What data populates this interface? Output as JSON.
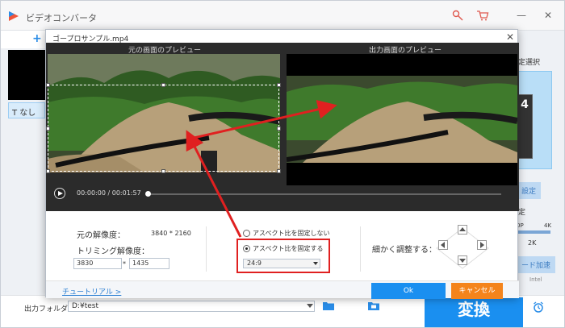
{
  "app": {
    "title": "ビデオコンバータ",
    "add_symbol": "+",
    "left_chip_label": "T なし",
    "minimize_symbol": "—",
    "close_symbol": "✕",
    "brand_colors": {
      "blue": "#1a8ff0",
      "orange": "#f4841c",
      "red": "#e02020"
    }
  },
  "right_panel": {
    "heading_partial": "定選択",
    "thumb_number": "4",
    "settings_partial": "設定",
    "quality_partial": "定",
    "res_labels": [
      "0P",
      "4K"
    ],
    "res_value": "2K",
    "accel_partial": "ード加速",
    "intel_label": "Intel"
  },
  "bottom": {
    "output_label": "出力フォルダ：",
    "output_path": "D:¥test",
    "convert_label": "変換"
  },
  "dialog": {
    "title": "ゴープロサンプル.mp4",
    "close_symbol": "✕",
    "original_preview_label": "元の画面のプレビュー",
    "output_preview_label": "出力画面のプレビュー",
    "current_time": "00:00:00",
    "duration": "/ 00:01:57",
    "playback_progress": 0.0,
    "original_resolution_label": "元の解像度：",
    "original_resolution_value": "3840 * 2160",
    "crop_resolution_label": "トリミング解像度：",
    "crop_width": "3830",
    "crop_separator": "*",
    "crop_height": "1435",
    "option_free_label": "アスペクト比を固定しない",
    "option_fixed_label": "アスペクト比を固定する",
    "option_selected": "fixed",
    "aspect_ratio_value": "24:9",
    "fine_adjust_label": "細かく調整する：",
    "tutorial_link": "チュートリアル >",
    "ok_label": "Ok",
    "cancel_label": "キャンセル"
  }
}
